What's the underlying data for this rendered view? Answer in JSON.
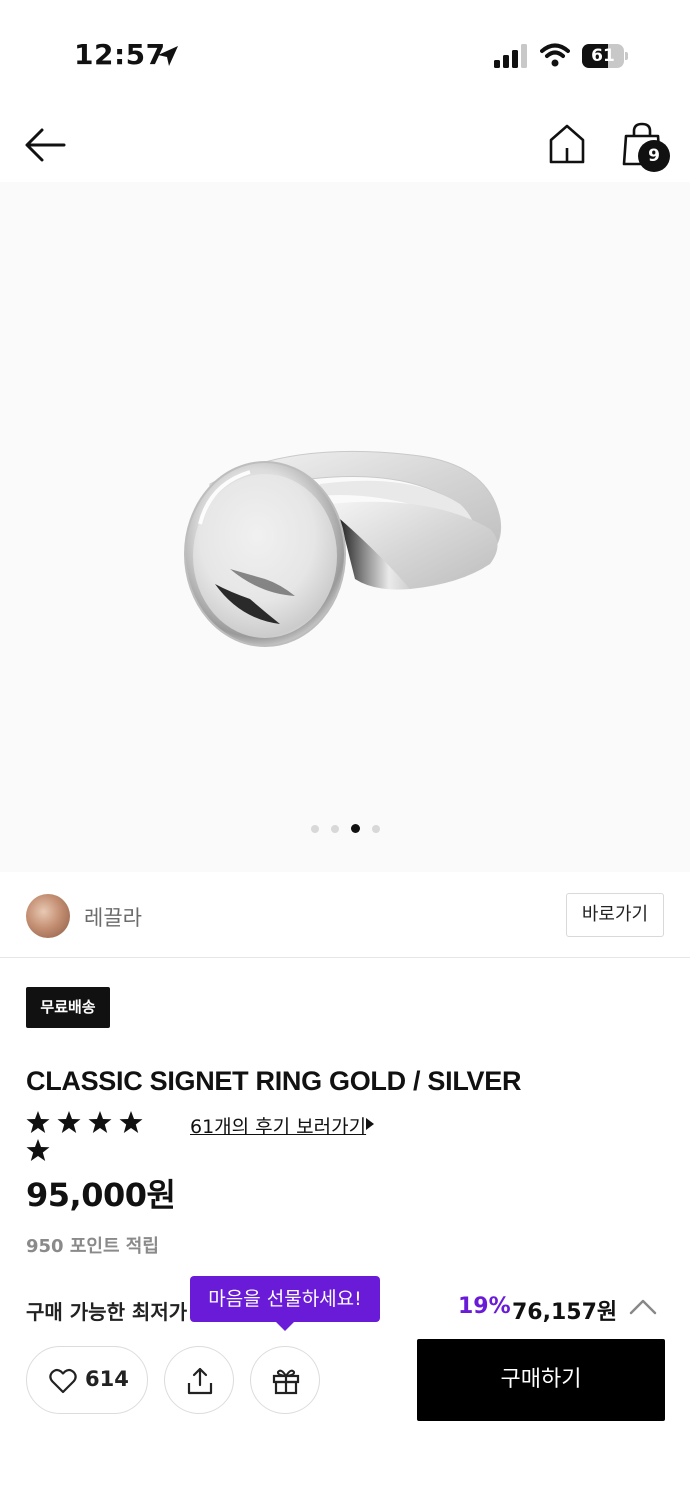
{
  "status_bar": {
    "time": "12:57",
    "battery": "61",
    "battery_level": 0.61,
    "icons": [
      "location-arrow-icon",
      "signal-icon",
      "wifi-icon",
      "battery-icon"
    ]
  },
  "nav": {
    "icons": [
      "back-arrow-icon",
      "home-icon",
      "shopping-bag-icon"
    ],
    "cart_count": "9"
  },
  "gallery": {
    "image": "silver-signet-ring",
    "page_count": 4,
    "active_index": 2
  },
  "brand": {
    "name": "레끌라",
    "link_label": "바로가기"
  },
  "product": {
    "badge": "무료배송",
    "title": "CLASSIC SIGNET RING GOLD / SILVER",
    "rating_stars": 5,
    "review_link": "61개의 후기 보러가기",
    "price": "95,000원",
    "points": "950 포인트 적립"
  },
  "lowest_price": {
    "label": "구매 가능한 최저가",
    "discount": "19%",
    "price": "76,157원"
  },
  "tooltip": {
    "text": "마음을 선물하세요!"
  },
  "actions": {
    "like_count": "614",
    "buy_label": "구매하기"
  },
  "colors": {
    "accent": "#6a1bd8",
    "primary": "#000000",
    "text": "#111111",
    "muted": "#8a8a8a"
  }
}
